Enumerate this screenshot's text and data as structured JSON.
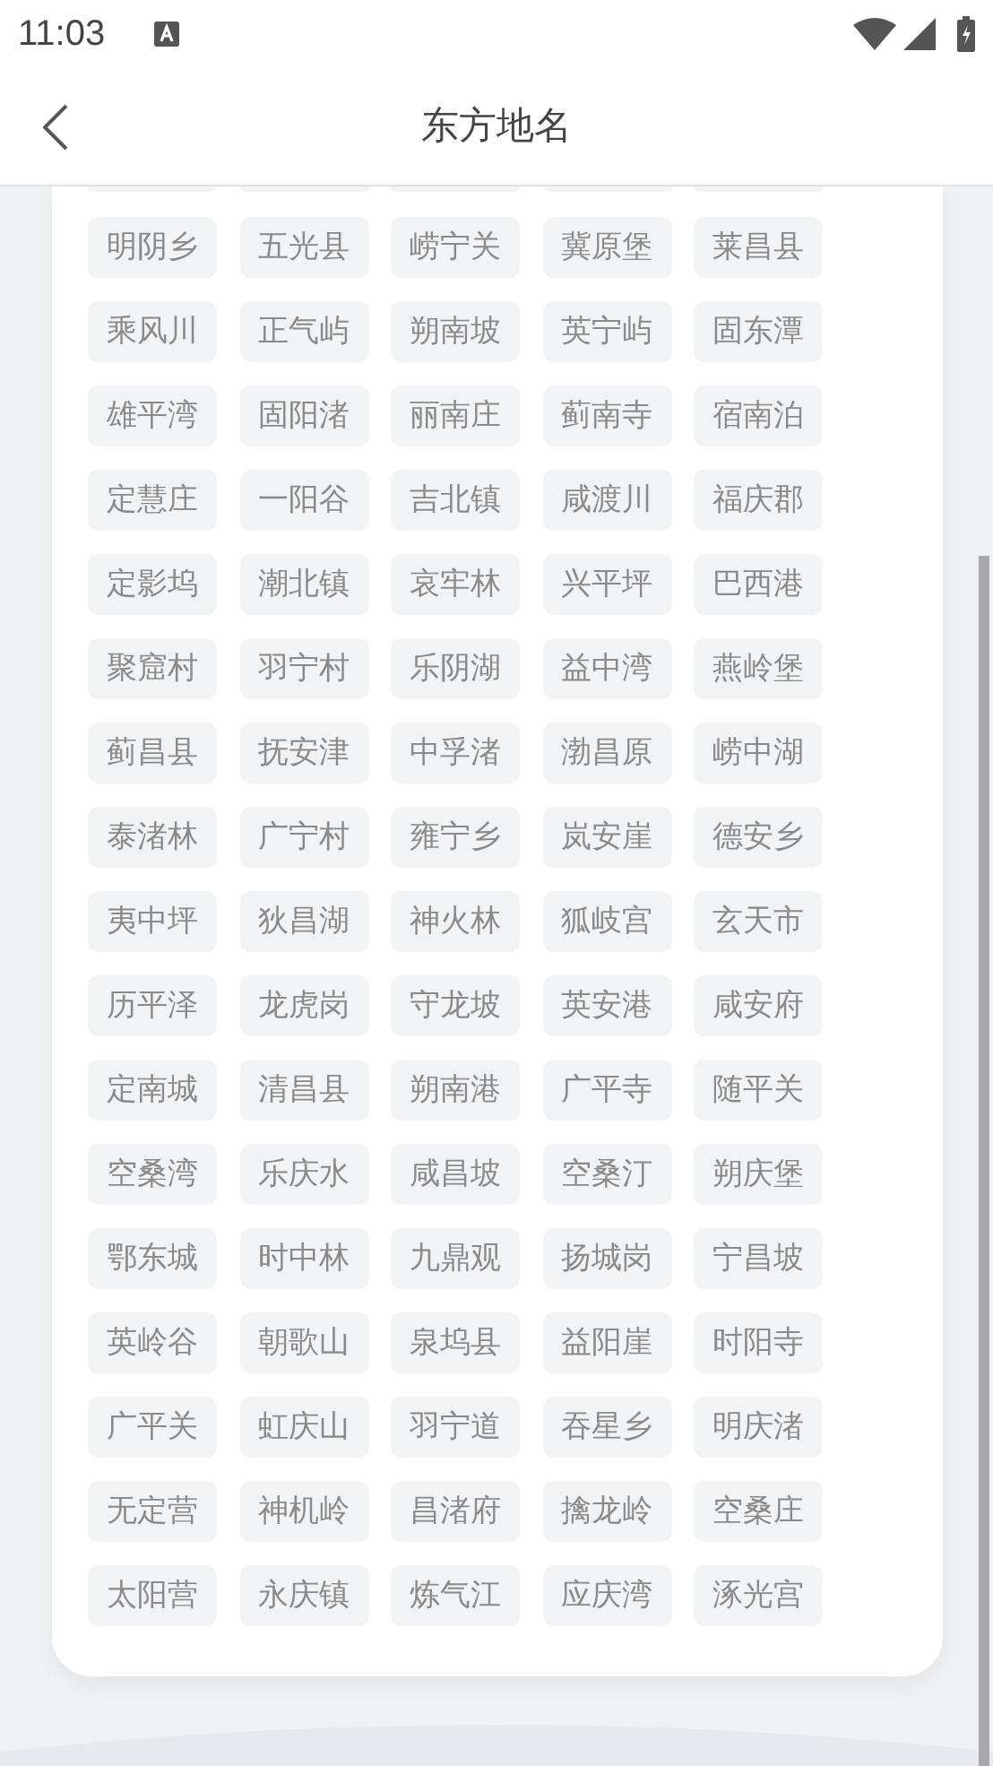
{
  "status_bar": {
    "time": "11:03"
  },
  "header": {
    "title": "东方地名"
  },
  "places": [
    "明阴乡",
    "五光县",
    "崂宁关",
    "冀原堡",
    "莱昌县",
    "乘风川",
    "正气屿",
    "朔南坡",
    "英宁屿",
    "固东潭",
    "雄平湾",
    "固阳渚",
    "丽南庄",
    "蓟南寺",
    "宿南泊",
    "定慧庄",
    "一阳谷",
    "吉北镇",
    "咸渡川",
    "福庆郡",
    "定影坞",
    "潮北镇",
    "哀牢林",
    "兴平坪",
    "巴西港",
    "聚窟村",
    "羽宁村",
    "乐阴湖",
    "益中湾",
    "燕岭堡",
    "蓟昌县",
    "抚安津",
    "中孚渚",
    "渤昌原",
    "崂中湖",
    "泰渚林",
    "广宁村",
    "雍宁乡",
    "岚安崖",
    "德安乡",
    "夷中坪",
    "狄昌湖",
    "神火林",
    "狐岐宫",
    "玄天市",
    "历平泽",
    "龙虎岗",
    "守龙坡",
    "英安港",
    "咸安府",
    "定南城",
    "清昌县",
    "朔南港",
    "广平寺",
    "随平关",
    "空桑湾",
    "乐庆水",
    "咸昌坡",
    "空桑汀",
    "朔庆堡",
    "鄂东城",
    "时中林",
    "九鼎观",
    "扬城岗",
    "宁昌坡",
    "英岭谷",
    "朝歌山",
    "泉坞县",
    "益阳崖",
    "时阳寺",
    "广平关",
    "虹庆山",
    "羽宁道",
    "吞星乡",
    "明庆渚",
    "无定营",
    "神机岭",
    "昌渚府",
    "擒龙岭",
    "空桑庄",
    "太阳营",
    "永庆镇",
    "炼气江",
    "应庆湾",
    "涿光宫"
  ]
}
